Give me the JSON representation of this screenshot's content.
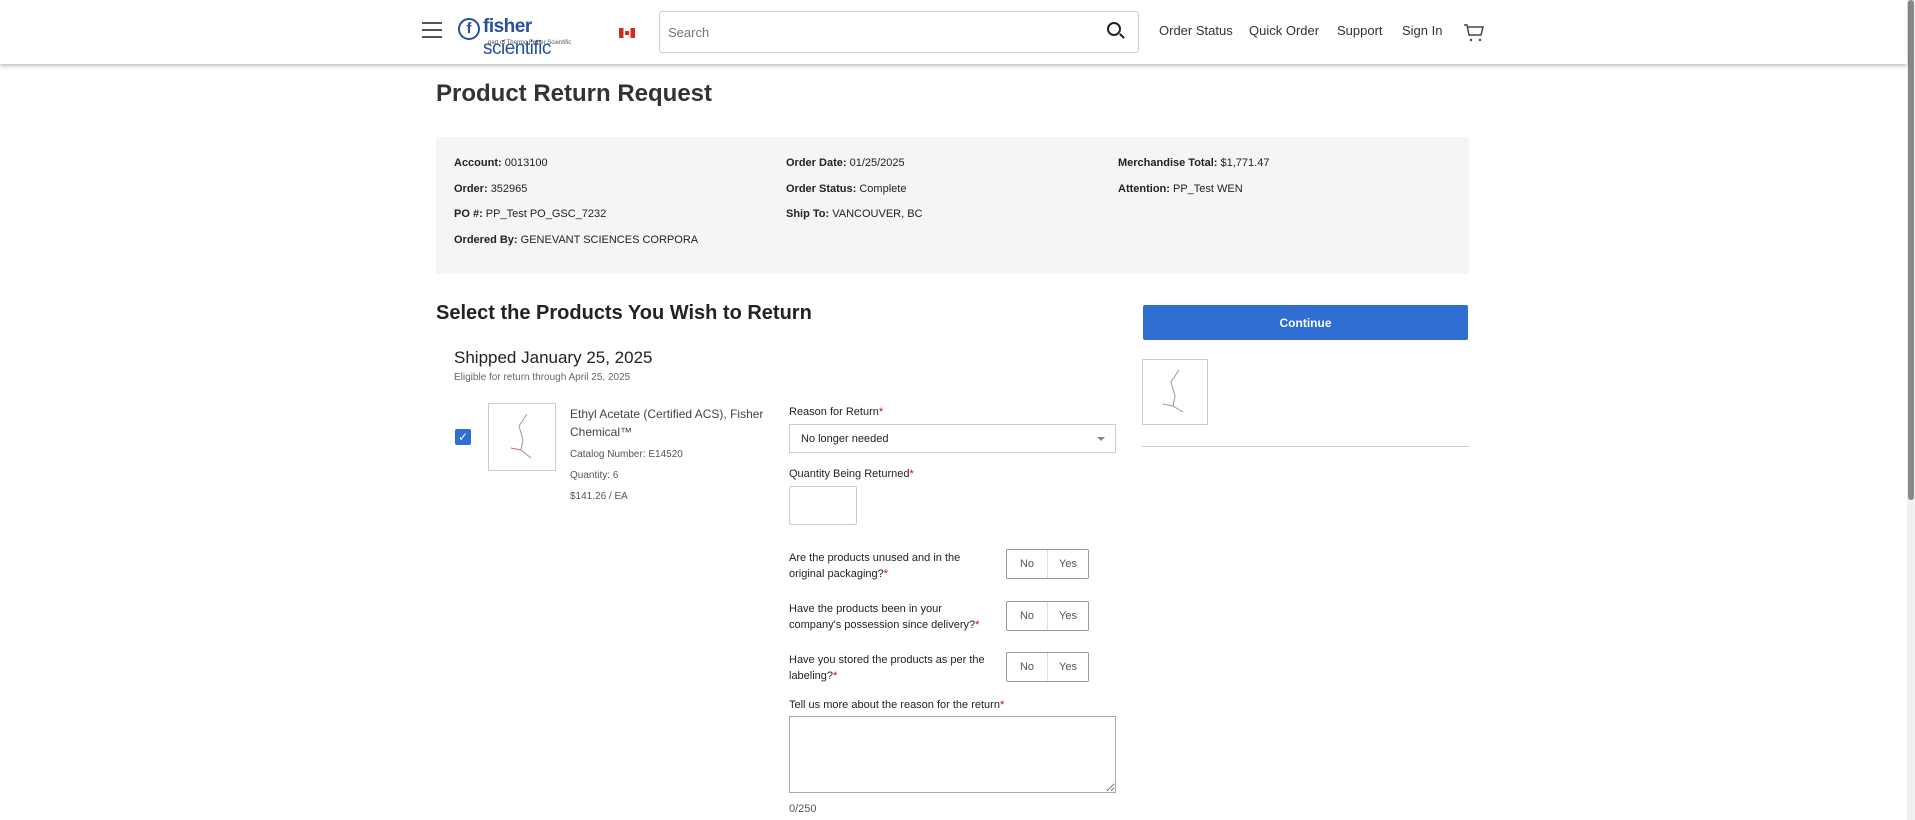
{
  "header": {
    "logo_text": "fisher scientific",
    "logo_sub": "part of Thermo Fisher Scientific",
    "search_placeholder": "Search",
    "nav": [
      "Order Status",
      "Quick Order",
      "Support",
      "Sign In"
    ]
  },
  "page_title": "Product Return Request",
  "order_info": {
    "account": {
      "label": "Account:",
      "value": "0013100"
    },
    "order": {
      "label": "Order:",
      "value": "352965"
    },
    "po": {
      "label": "PO #:",
      "value": "PP_Test PO_GSC_7232"
    },
    "ordered_by": {
      "label": "Ordered By:",
      "value": "GENEVANT SCIENCES CORPORA"
    },
    "order_date": {
      "label": "Order Date:",
      "value": "01/25/2025"
    },
    "order_status": {
      "label": "Order Status:",
      "value": "Complete"
    },
    "ship_to": {
      "label": "Ship To:",
      "value": "VANCOUVER, BC"
    },
    "merch_total": {
      "label": "Merchandise Total:",
      "value": "$1,771.47"
    },
    "attention": {
      "label": "Attention:",
      "value": "PP_Test WEN"
    }
  },
  "section_title": "Select the Products You Wish to Return",
  "continue_label": "Continue",
  "shipment": {
    "title": "Shipped January 25, 2025",
    "eligible": "Eligible for return through April 25, 2025"
  },
  "product": {
    "name": "Ethyl Acetate (Certified ACS), Fisher Chemical™",
    "catalog": "Catalog Number: E14520",
    "quantity": "Quantity: 6",
    "price": "$141.26 / EA",
    "checked": true
  },
  "form": {
    "reason_label": "Reason for Return",
    "reason_value": "No longer needed",
    "qty_label": "Quantity Being Returned",
    "qty_value": "",
    "questions": [
      "Are the products unused and in the original packaging?",
      "Have the products been in your company's possession since delivery?",
      "Have you stored the products as per the labeling?"
    ],
    "no": "No",
    "yes": "Yes",
    "more_label": "Tell us more about the reason for the return",
    "char_count": "0/250",
    "required_mark": "*"
  }
}
